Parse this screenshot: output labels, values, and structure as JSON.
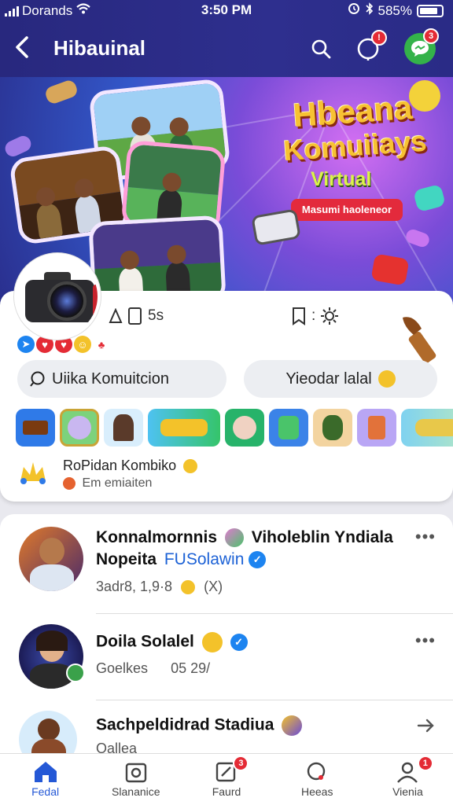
{
  "status_bar": {
    "carrier": "Dorands",
    "time": "3:50 PM",
    "battery": "585%"
  },
  "header": {
    "title": "Hibauinal",
    "notification_badge": "!",
    "messenger_badge": "3"
  },
  "banner": {
    "title_line1": "Hbeana",
    "title_line2": "Komuiiays",
    "subtitle": "Virtual",
    "pill": "Masumi haoleneor"
  },
  "card": {
    "meta_left": "5s",
    "meta_right": ":",
    "left_button": "Uiika Komuitcion",
    "right_button": "Yieodar lalal",
    "recommendation_title": "RoPidan Kombiko",
    "recommendation_sub": "Em emiaiten"
  },
  "feed": {
    "posts": [
      {
        "name_line1": "Konnalmornnis",
        "name_line1b": "Viholeblin Yndiala",
        "name_line2": "Nopeita",
        "tag": "FUSolawin",
        "sub": "3adr8, 1,9·8",
        "sub_extra": "(X)"
      },
      {
        "name": "Doila Solalel",
        "sub": "Goelkes",
        "sub_extra": "05 29/"
      },
      {
        "name": "Sachpeldidrad Stadiua",
        "sub": "Oalleа"
      }
    ]
  },
  "bottom_nav": [
    {
      "label": "Fedal",
      "badge": ""
    },
    {
      "label": "Slananice",
      "badge": ""
    },
    {
      "label": "Faurd",
      "badge": "3"
    },
    {
      "label": "Heeas",
      "badge": ""
    },
    {
      "label": "Vienia",
      "badge": "1"
    }
  ],
  "colors": {
    "header_bg": "#2e2f8e",
    "accent": "#2458d6",
    "badge": "#e42b35",
    "verified": "#1d84f0"
  }
}
